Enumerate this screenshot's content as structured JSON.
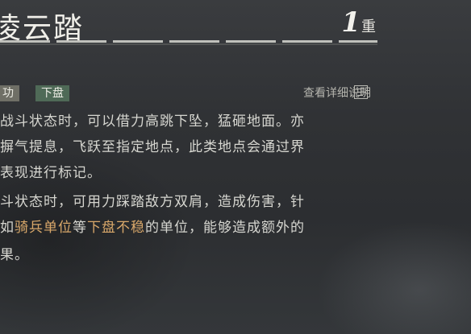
{
  "skill": {
    "title": "凌云踏",
    "level_number": "1",
    "level_unit": "重"
  },
  "tags": [
    "功",
    "下盘"
  ],
  "detail_link": "查看详细说明",
  "description_lines": [
    {
      "segments": [
        {
          "text": "战斗状态时，可以借力高跳下坠，猛砸地面。亦",
          "highlight": false
        }
      ]
    },
    {
      "segments": [
        {
          "text": "摒气提息，飞跃至指定地点，此类地点会通过界",
          "highlight": false
        }
      ]
    },
    {
      "segments": [
        {
          "text": "表现进行标记。",
          "highlight": false
        }
      ]
    },
    {
      "segments": [
        {
          "text": "斗状态时，可用力踩踏敌方双肩，造成伤害，针",
          "highlight": false
        }
      ]
    },
    {
      "segments": [
        {
          "text": "如",
          "highlight": false
        },
        {
          "text": "骑兵单位",
          "highlight": true
        },
        {
          "text": "等",
          "highlight": false
        },
        {
          "text": "下盘不稳",
          "highlight": true
        },
        {
          "text": "的单位，能够造成额外的",
          "highlight": false
        }
      ]
    },
    {
      "segments": [
        {
          "text": "果。",
          "highlight": false
        }
      ]
    }
  ],
  "colors": {
    "highlight": "#d9a86a",
    "tag_gong": "#6f6f66",
    "tag_xiapan": "#4f6a57"
  }
}
